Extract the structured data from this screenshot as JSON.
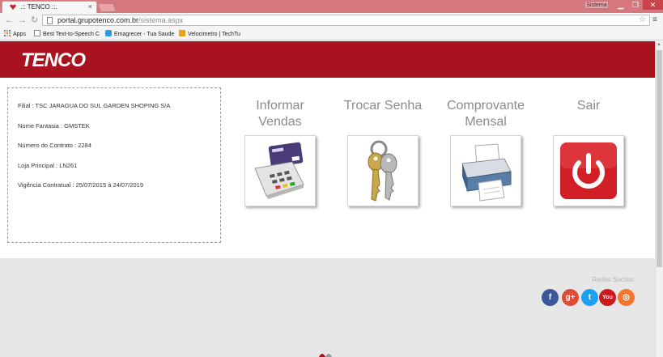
{
  "browser": {
    "tab_title": ".:: TENCO ::.",
    "tab_close": "×",
    "sistema_label": "Sistema",
    "url_host": "portal.grupotenco.com.br",
    "url_path": "/sistema.aspx",
    "bookmarks": [
      "Apps",
      "Best Text-to-Speech C",
      "Emagrecer - Tua Saude",
      "Velocimetro | TechTu"
    ]
  },
  "header": {
    "logo_text": "TENCO"
  },
  "info": {
    "filial": "Filial : TSC JARAGUA DO SUL GARDEN SHOPING S/A",
    "nome_fantasia": "Nome Fantasia : GMSTEK",
    "numero_contrato": "Número do Contrato : 2284",
    "loja_principal": "Loja Principal : LN261",
    "vigencia": "Vigência Contratual : 25/07/2015 à 24/07/2019"
  },
  "actions": {
    "informar_line1": "Informar",
    "informar_line2": "Vendas",
    "trocar": "Trocar Senha",
    "comprovante_line1": "Comprovante",
    "comprovante_line2": "Mensal",
    "sair": "Sair"
  },
  "icons": {
    "informar": "card-terminal-icon",
    "trocar": "keys-icon",
    "comprovante": "printer-icon",
    "sair": "power-icon"
  },
  "footer": {
    "social_label": "Redes Sociais:",
    "networks": [
      {
        "name": "facebook",
        "glyph": "f",
        "color": "#3b5998"
      },
      {
        "name": "google-plus",
        "glyph": "g+",
        "color": "#dd4b39"
      },
      {
        "name": "twitter",
        "glyph": "t",
        "color": "#1da1f2"
      },
      {
        "name": "youtube",
        "glyph": "You",
        "color": "#cc181e"
      },
      {
        "name": "instagram",
        "glyph": "◎",
        "color": "#f2762e"
      }
    ]
  },
  "colors": {
    "header_red": "#a8131f",
    "footer_gray": "#e7e7e7",
    "label_gray": "#8a8a8a"
  }
}
